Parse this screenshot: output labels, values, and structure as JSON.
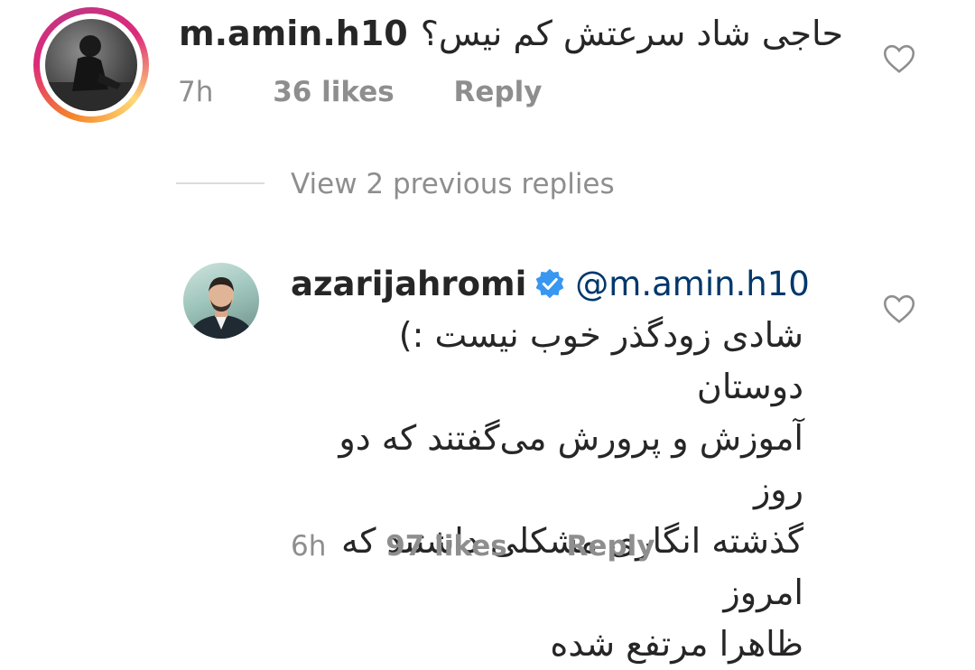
{
  "comment1": {
    "username": "m.amin.h10",
    "text": "حاجی شاد سرعتش کم نیس؟",
    "time": "7h",
    "likes": "36 likes",
    "reply": "Reply"
  },
  "view_replies": {
    "label": "View 2 previous replies"
  },
  "comment2": {
    "username": "azarijahromi",
    "verified": true,
    "mention": "@m.amin.h10",
    "lines": [
      "شادی زودگذر خوب نیست :) دوستان",
      "آموزش و پرورش می‌گفتند که دو روز",
      "گذشته انگاری مشکلی داشتند که امروز",
      "ظاهرا مرتفع شده"
    ],
    "time": "6h",
    "likes": "97 likes",
    "reply": "Reply"
  },
  "colors": {
    "text": "#262626",
    "secondary": "#8e8e8e",
    "verified_blue": "#3897f0",
    "mention": "#00376b",
    "divider": "#dbdbdb"
  },
  "icons": [
    "heart-icon",
    "verified-badge-icon"
  ]
}
